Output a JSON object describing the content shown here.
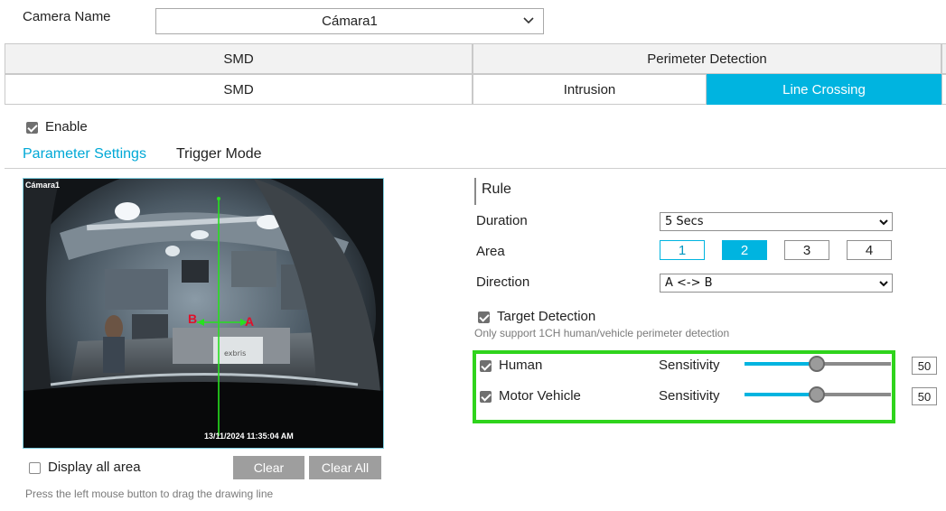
{
  "camera": {
    "label": "Camera Name",
    "value": "Cámara1"
  },
  "tabs_row1": [
    "SMD",
    "Perimeter Detection"
  ],
  "tabs_row2": [
    "SMD",
    "Intrusion",
    "Line Crossing"
  ],
  "enable": {
    "label": "Enable",
    "checked": true
  },
  "subtabs": [
    "Parameter Settings",
    "Trigger Mode"
  ],
  "preview": {
    "overlay_name": "Cámara1",
    "timestamp": "13/11/2024 11:35:04 AM",
    "line_label_a": "A",
    "line_label_b": "B",
    "sign_text": "exbris"
  },
  "rule": {
    "title": "Rule",
    "duration_label": "Duration",
    "duration_value": "5 Secs",
    "area_label": "Area",
    "areas": [
      "1",
      "2",
      "3",
      "4"
    ],
    "selected_area": "2",
    "direction_label": "Direction",
    "direction_value": "A <-> B"
  },
  "target_detection": {
    "label": "Target Detection",
    "checked": true,
    "note": "Only support 1CH human/vehicle perimeter detection",
    "items": [
      {
        "label": "Human",
        "checked": true,
        "sensitivity_label": "Sensitivity",
        "value": "50",
        "level": 0.5
      },
      {
        "label": "Motor Vehicle",
        "checked": true,
        "sensitivity_label": "Sensitivity",
        "value": "50",
        "level": 0.5
      }
    ]
  },
  "display_all": {
    "label": "Display all area",
    "checked": false
  },
  "buttons": {
    "clear": "Clear",
    "clear_all": "Clear All"
  },
  "hint": "Press the left mouse button to drag the drawing line",
  "colors": {
    "accent": "#00b4e0",
    "highlight": "#2fd41c",
    "button_gray": "#9e9e9e"
  }
}
